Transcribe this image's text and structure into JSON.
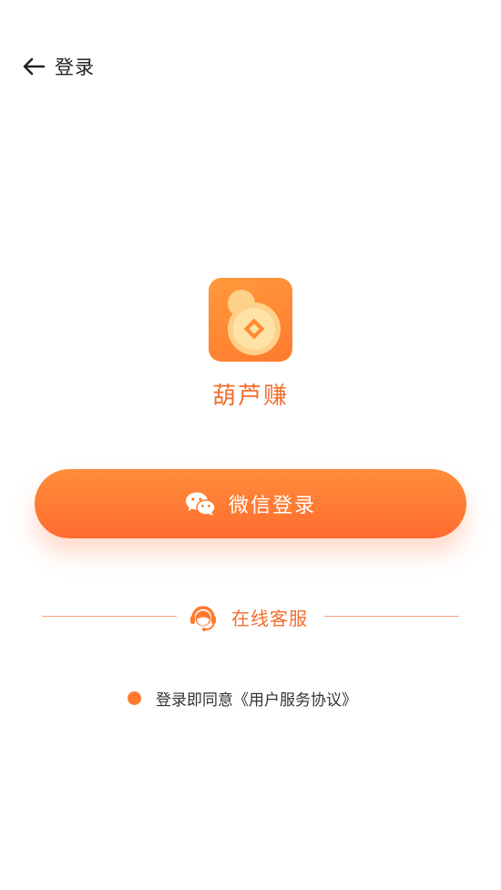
{
  "header": {
    "back_icon": "arrow-left-icon",
    "title": "登录"
  },
  "app": {
    "logo_icon": "gourd-coin-icon",
    "name": "葫芦赚"
  },
  "login": {
    "wechat_icon": "wechat-icon",
    "wechat_label": "微信登录"
  },
  "service": {
    "icon": "headset-icon",
    "label": "在线客服"
  },
  "agreement": {
    "prefix": "登录即同意",
    "link": "《用户服务协议》"
  },
  "colors": {
    "accent": "#ff7a2e",
    "accent_text": "#f26e2c",
    "divider": "#f4a57a"
  }
}
